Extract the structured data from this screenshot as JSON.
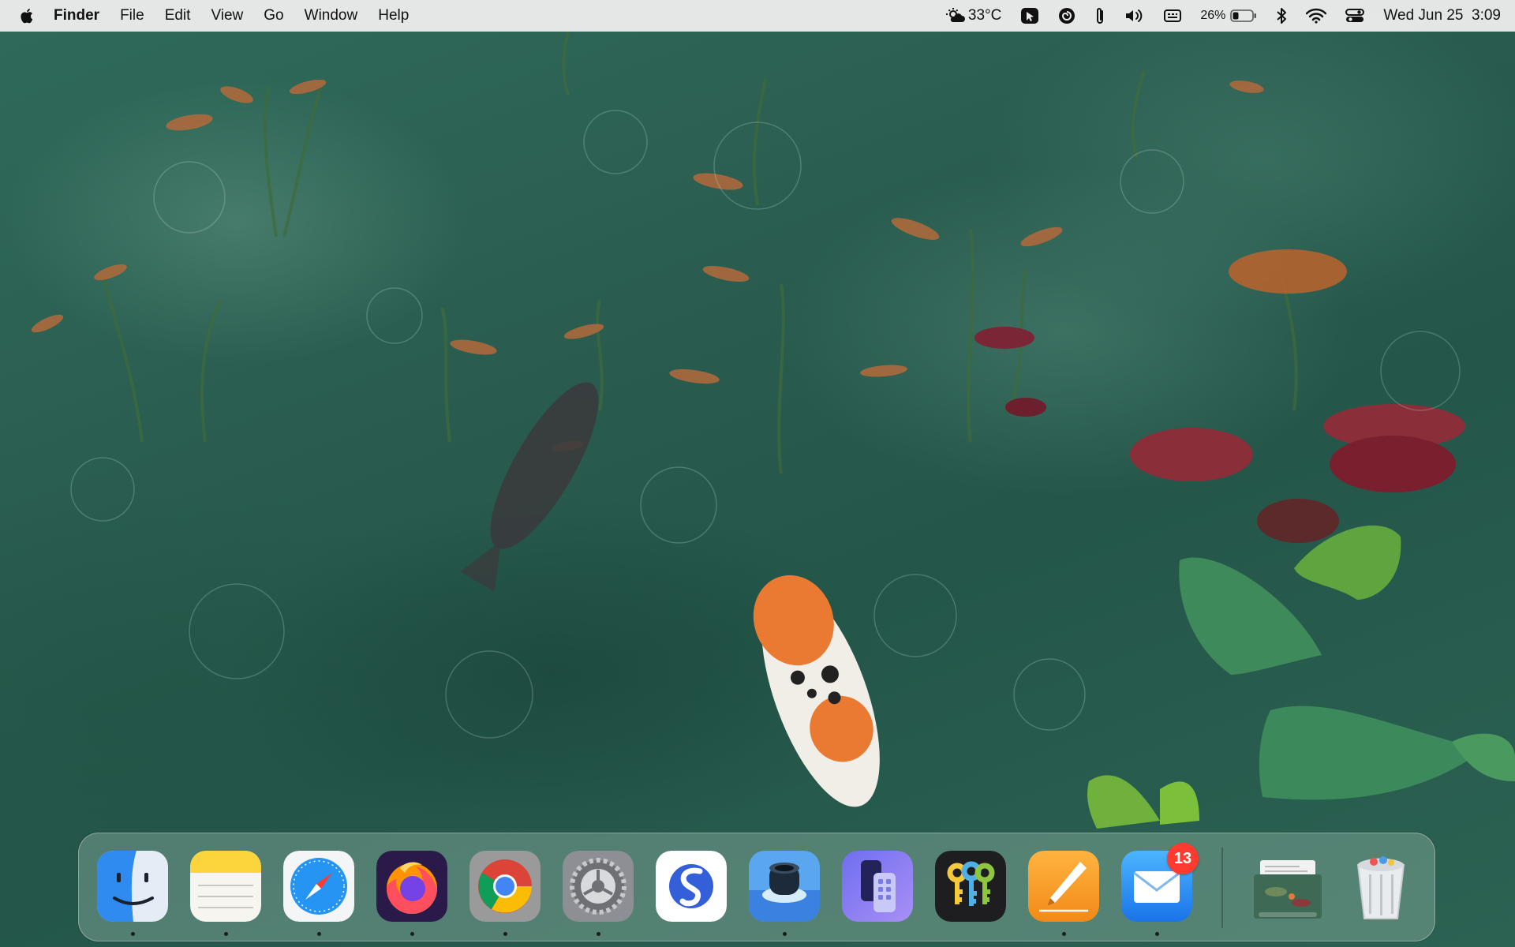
{
  "menubar": {
    "app_name": "Finder",
    "menus": [
      "File",
      "Edit",
      "View",
      "Go",
      "Window",
      "Help"
    ],
    "weather": "33°C",
    "battery_percent": "26%",
    "clock": "Wed Jun 25  3:09"
  },
  "dock": {
    "apps": [
      {
        "name": "Finder",
        "icon": "finder-icon",
        "running": true
      },
      {
        "name": "Notes",
        "icon": "notes-icon",
        "running": true
      },
      {
        "name": "Safari",
        "icon": "safari-icon",
        "running": true
      },
      {
        "name": "Firefox",
        "icon": "firefox-icon",
        "running": true
      },
      {
        "name": "Chrome",
        "icon": "chrome-icon",
        "running": true
      },
      {
        "name": "System Settings",
        "icon": "settings-gear-icon",
        "running": true
      },
      {
        "name": "Simplenote",
        "icon": "simplenote-icon",
        "running": false
      },
      {
        "name": "Spotlight Lens",
        "icon": "lens-icon",
        "running": true
      },
      {
        "name": "Device Manager",
        "icon": "devices-icon",
        "running": false
      },
      {
        "name": "Keychain Access",
        "icon": "keychain-icon",
        "running": false
      },
      {
        "name": "Pages",
        "icon": "pages-pen-icon",
        "running": true
      },
      {
        "name": "Mail",
        "icon": "mail-icon",
        "running": true,
        "badge": "13"
      }
    ],
    "others": [
      {
        "name": "Downloads Stack",
        "icon": "stack-thumbnail-icon"
      },
      {
        "name": "Trash",
        "icon": "trash-icon"
      }
    ]
  },
  "colors": {
    "menubar_bg": "#ececec",
    "badge": "#ff3b30",
    "water": "#2c5a4e"
  }
}
